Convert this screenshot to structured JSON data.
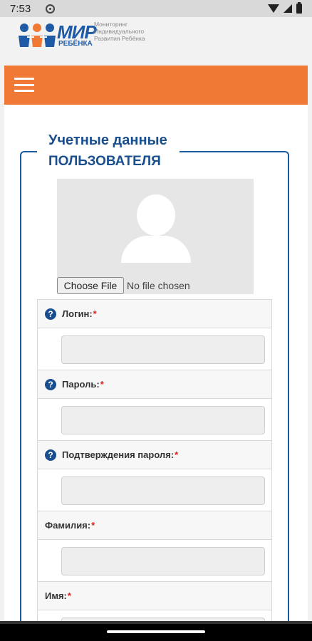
{
  "status_bar": {
    "time": "7:53",
    "icons": [
      "notification-icon",
      "wifi-icon",
      "signal-icon",
      "battery-icon"
    ]
  },
  "logo": {
    "name_main": "МИР",
    "name_sub": "РЕБЁНКА",
    "tagline": "Мониторинг Индивидуального Развития Ребёнка"
  },
  "navbar": {
    "menu_icon": "hamburger-menu-icon",
    "color": "#f07a35"
  },
  "section": {
    "title_line1": "Учетные данные",
    "title_line2": "ПОЛЬЗОВАТЕЛЯ"
  },
  "avatar": {
    "icon": "user-placeholder-icon",
    "file_button": "Choose File",
    "file_status": "No file chosen"
  },
  "fields": [
    {
      "label": "Логин:",
      "required": "*",
      "has_help": true,
      "value": ""
    },
    {
      "label": "Пароль:",
      "required": "*",
      "has_help": true,
      "value": ""
    },
    {
      "label": "Подтверждения пароля:",
      "required": "*",
      "has_help": true,
      "value": ""
    },
    {
      "label": "Фамилия:",
      "required": "*",
      "has_help": false,
      "value": ""
    },
    {
      "label": "Имя:",
      "required": "*",
      "has_help": false,
      "value": ""
    }
  ],
  "help_glyph": "?",
  "colors": {
    "accent_blue": "#1a4f8f",
    "required_red": "#d9231d"
  }
}
